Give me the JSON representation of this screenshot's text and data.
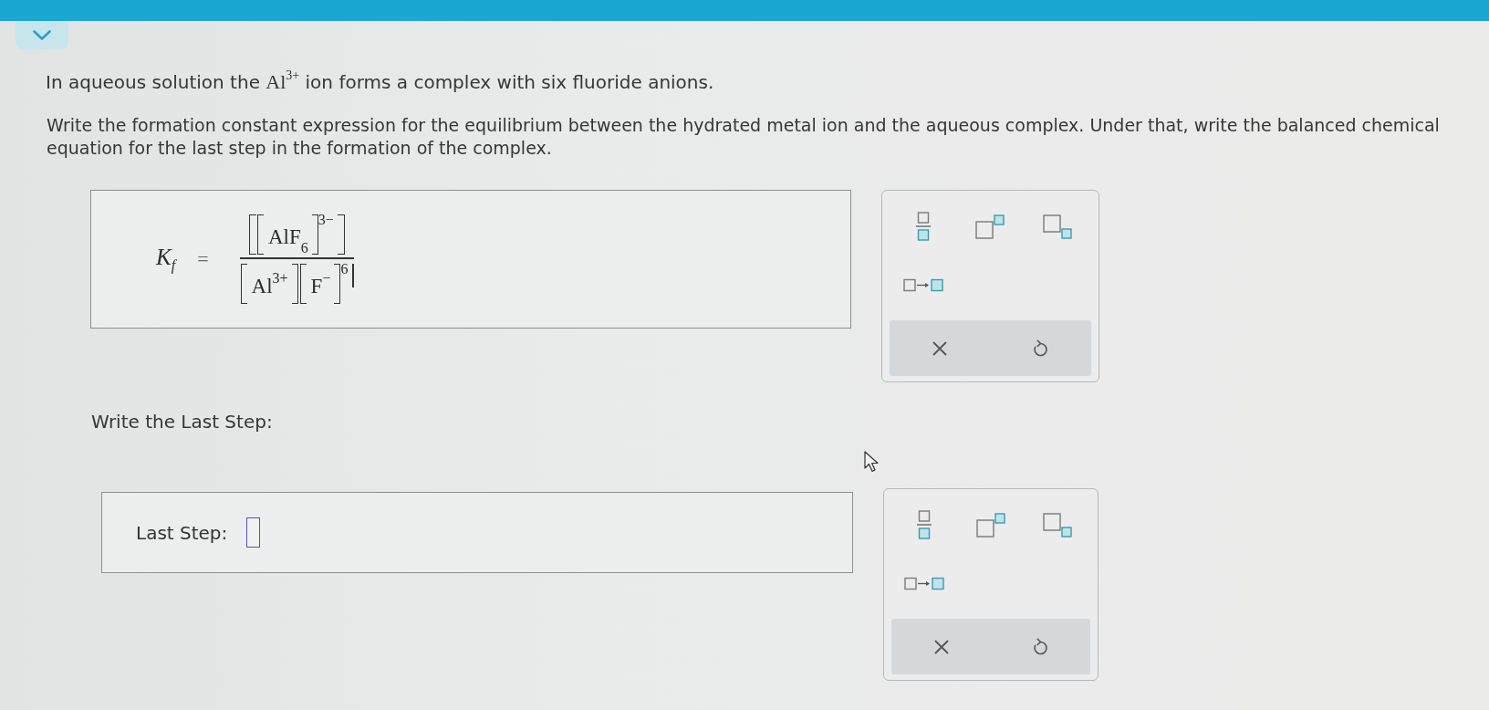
{
  "question": {
    "intro": {
      "before": "In aqueous solution the",
      "ion": "Al",
      "ion_charge": "3+",
      "after": "ion forms a complex with six fluoride anions."
    },
    "instructions": "Write the formation constant expression for the equilibrium between the hydrated metal ion and the aqueous complex. Under that, write the balanced chemical equation for the last step in the formation of the complex."
  },
  "parts": [
    {
      "kind": "expression",
      "answer": {
        "symbol": "K",
        "symbol_subscript": "f",
        "equals": "=",
        "numerator": {
          "outer_brackets": true,
          "groups": [
            {
              "text": "AlF",
              "subscript": "6",
              "power": "3−"
            }
          ]
        },
        "denominator": {
          "outer_brackets": false,
          "groups": [
            {
              "text": "Al",
              "superscript": "3+"
            },
            {
              "text": "F",
              "superscript": "−",
              "power": "6"
            }
          ]
        }
      }
    },
    {
      "kind": "equation",
      "prompt": "Write the Last Step:",
      "label": "Last Step:"
    }
  ]
}
